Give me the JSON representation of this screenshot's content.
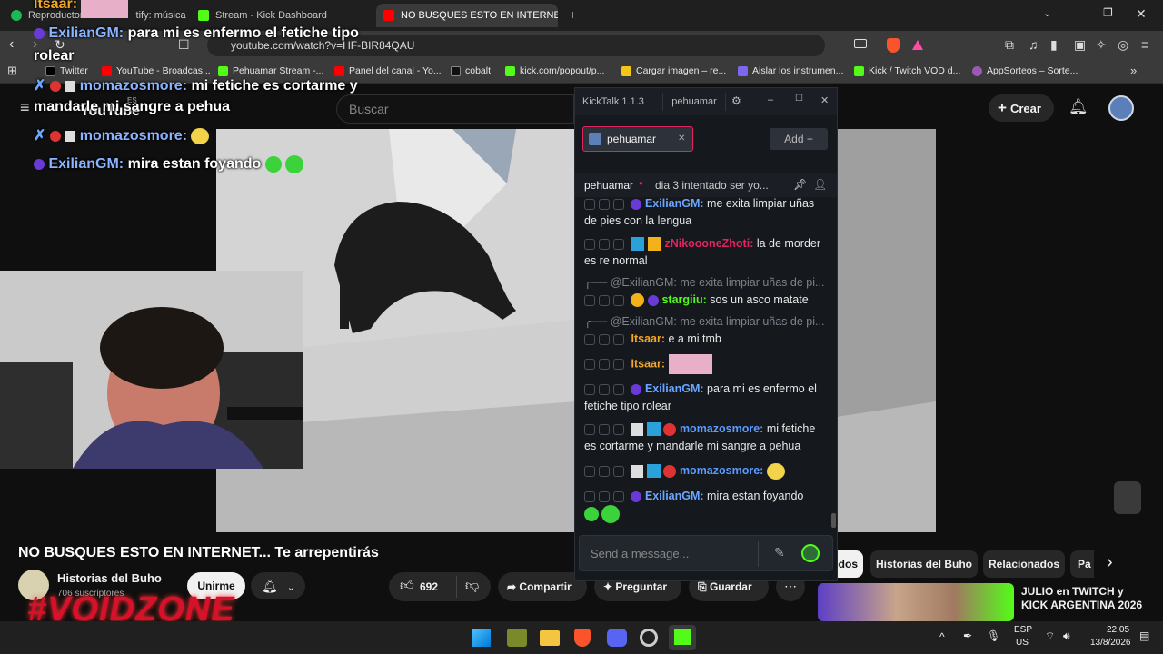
{
  "browser": {
    "tabs": [
      {
        "label": "Reproductor",
        "label2": "tify: música",
        "color": "#1db954"
      },
      {
        "label": "Stream - Kick Dashboard",
        "color": "#53fc18"
      },
      {
        "label": "NO BUSQUES ESTO EN INTERNE",
        "color": "#ff0000",
        "active": true
      }
    ],
    "url": "youtube.com/watch?v=HF-BIR84QAU",
    "bookmarks": [
      {
        "label": "Twitter",
        "color": "#000000"
      },
      {
        "label": "YouTube - Broadcas...",
        "color": "#ff0000"
      },
      {
        "label": "Pehuamar Stream -...",
        "color": "#53fc18"
      },
      {
        "label": "Panel del canal - Yo...",
        "color": "#ff0000"
      },
      {
        "label": "cobalt",
        "color": "#111111"
      },
      {
        "label": "kick.com/popout/p...",
        "color": "#53fc18"
      },
      {
        "label": "Cargar imagen – re...",
        "color": "#f5c518"
      },
      {
        "label": "Aislar los instrumen...",
        "color": "#7b68ee"
      },
      {
        "label": "Kick / Twitch VOD d...",
        "color": "#53fc18"
      },
      {
        "label": "AppSorteos – Sorte...",
        "color": "#9b59b6"
      }
    ]
  },
  "youtube": {
    "logo": "YouTube",
    "country": "ES",
    "search_placeholder": "Buscar",
    "create_label": "Crear",
    "video_title": "NO BUSQUES ESTO EN INTERNET... Te arrepentirás",
    "channel": "Historias del Buho",
    "subs": "706 suscriptores",
    "join": "Unirme",
    "likes": "692",
    "share": "Compartir",
    "ask": "Preguntar",
    "save": "Guardar",
    "chips": [
      "Todos",
      "Historias del Buho",
      "Relacionados",
      "Pa"
    ],
    "rec_title": "JULIO en TWITCH y KICK ARGENTINA 2026"
  },
  "overlay": {
    "lines": [
      {
        "user": "Itsaar:",
        "text": "",
        "color": "#f5a623"
      },
      {
        "user": "ExilianGM:",
        "text": "para mi es enfermo el fetiche tipo",
        "color": "#6aa6ff"
      },
      {
        "user": "",
        "text": "rolear",
        "color": "#ffffff"
      },
      {
        "user": "momazosmore:",
        "text": "mi fetiche es cortarme y",
        "color": "#6aa6ff"
      },
      {
        "user": "",
        "text": "mandarle mi sangre a pehua",
        "color": "#ffffff"
      },
      {
        "user": "momazosmore:",
        "text": "",
        "color": "#6aa6ff"
      },
      {
        "user": "ExilianGM:",
        "text": "mira estan foyando",
        "color": "#6aa6ff"
      }
    ],
    "brand": "#VOIDZONE"
  },
  "kicktalk": {
    "app": "KickTalk 1.1.3",
    "user": "pehuamar",
    "channel_tab": "pehuamar",
    "add": "Add",
    "stream_name": "pehuamar",
    "stream_title": "dia 3 intentado ser yo...",
    "messages": [
      {
        "user": "ExilianGM:",
        "color": "#6aa6ff",
        "text": "me exita limpiar uñas de pies con la lengua"
      },
      {
        "user": "zNikoooneZhoti:",
        "color": "#e0245e",
        "text": "la de morder es re normal"
      },
      {
        "reply": "@ExilianGM: me exita limpiar uñas de pi..."
      },
      {
        "user": "stargiiu:",
        "color": "#53fc18",
        "text": "sos un asco matate"
      },
      {
        "reply": "@ExilianGM: me exita limpiar uñas de pi..."
      },
      {
        "user": "Itsaar:",
        "color": "#f5a623",
        "text": "e a mi tmb"
      },
      {
        "user": "Itsaar:",
        "color": "#f5a623",
        "text": ""
      },
      {
        "user": "ExilianGM:",
        "color": "#6aa6ff",
        "text": "para mi es enfermo el fetiche tipo rolear"
      },
      {
        "user": "momazosmore:",
        "color": "#5b9bff",
        "text": "mi fetiche es cortarme y mandarle mi sangre a pehua"
      },
      {
        "user": "momazosmore:",
        "color": "#5b9bff",
        "text": ""
      },
      {
        "user": "ExilianGM:",
        "color": "#6aa6ff",
        "text": "mira estan foyando"
      }
    ],
    "input_placeholder": "Send a message..."
  },
  "taskbar": {
    "lang": "ESP",
    "region": "US",
    "time": "22:05",
    "date": "13/8/2026"
  }
}
